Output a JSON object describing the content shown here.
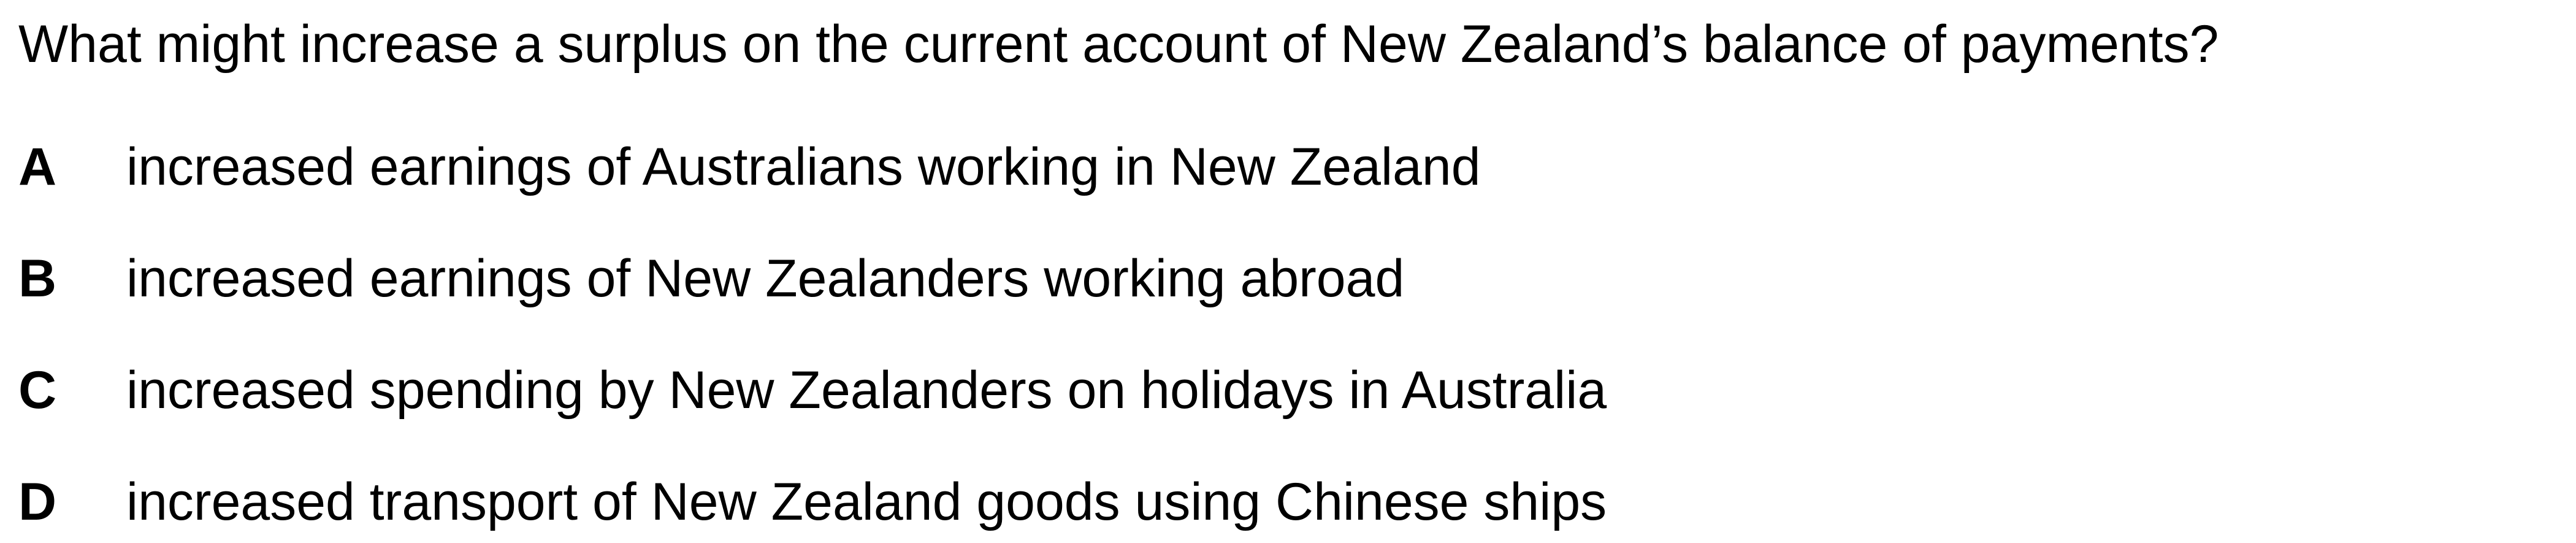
{
  "question": "What might increase a surplus on the current account of New Zealand’s balance of payments?",
  "options": [
    {
      "letter": "A",
      "text": "increased earnings of Australians working in New Zealand"
    },
    {
      "letter": "B",
      "text": "increased earnings of New Zealanders working abroad"
    },
    {
      "letter": "C",
      "text": "increased spending by New Zealanders on holidays in Australia"
    },
    {
      "letter": "D",
      "text": "increased transport of New Zealand goods using Chinese ships"
    }
  ]
}
